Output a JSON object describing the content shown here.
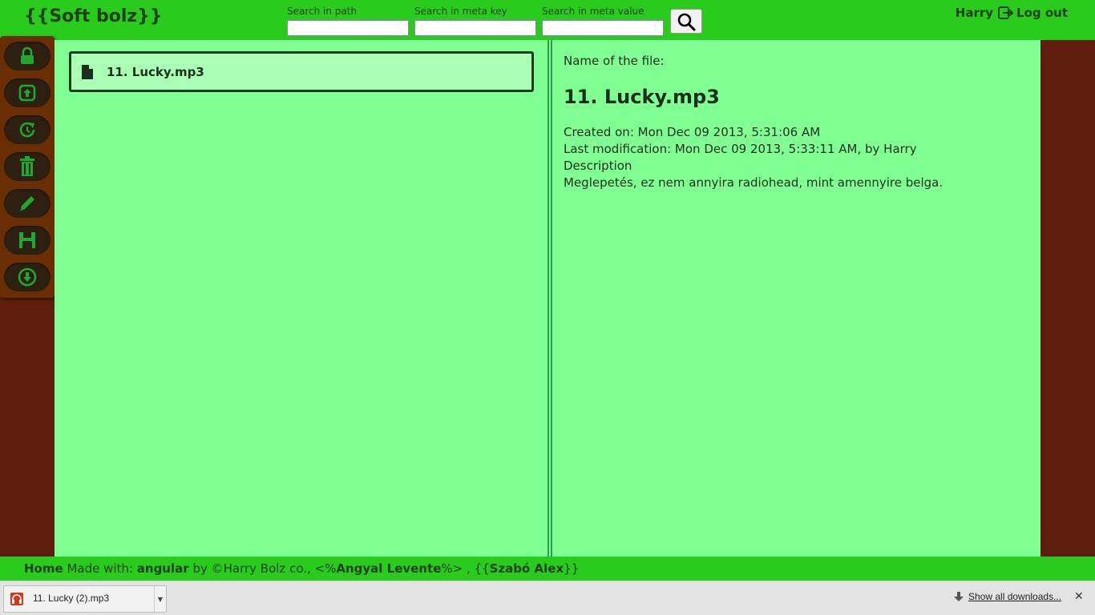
{
  "header": {
    "brand": "{{Soft bolz}}",
    "search_path_label": "Search in path",
    "search_key_label": "Search in meta key",
    "search_value_label": "Search in meta value",
    "search_path_value": "",
    "search_key_value": "",
    "search_value_value": "",
    "username": "Harry",
    "logout_label": "Log out"
  },
  "toolbar": {
    "items": [
      {
        "icon": "lock-icon"
      },
      {
        "icon": "upload-icon"
      },
      {
        "icon": "refresh-icon"
      },
      {
        "icon": "trash-icon"
      },
      {
        "icon": "pencil-icon"
      },
      {
        "icon": "save-icon"
      },
      {
        "icon": "download-icon"
      }
    ],
    "icon_color": "#1fa82f"
  },
  "files": [
    {
      "name": "11. Lucky.mp3",
      "selected": true
    }
  ],
  "details": {
    "name_label": "Name of the file:",
    "file_name": "11. Lucky.mp3",
    "created": "Created on: Mon Dec 09 2013, 5:31:06 AM",
    "modified": "Last modification: Mon Dec 09 2013, 5:33:11 AM, by Harry",
    "description_label": "Description",
    "description": "Meglepetés, ez nem annyira radiohead, mint amennyire belga."
  },
  "footer": {
    "home": "Home",
    "made_with": "Made with:",
    "framework": "angular",
    "by": "by ©Harry Bolz co.,",
    "author1_prefix": "<%",
    "author1": "Angyal Levente",
    "author1_suffix": "%>",
    "comma": ",",
    "author2_prefix": "{{",
    "author2": "Szabó Alex",
    "author2_suffix": "}}"
  },
  "downloads": {
    "item_name": "11. Lucky (2).mp3",
    "show_all": "Show all downloads...",
    "close": "✕"
  },
  "colors": {
    "header_bg": "#29cc1d",
    "main_bg": "#80ff92",
    "side_bg": "#5f1e0d",
    "toolbar_bg": "#6a2e04"
  }
}
